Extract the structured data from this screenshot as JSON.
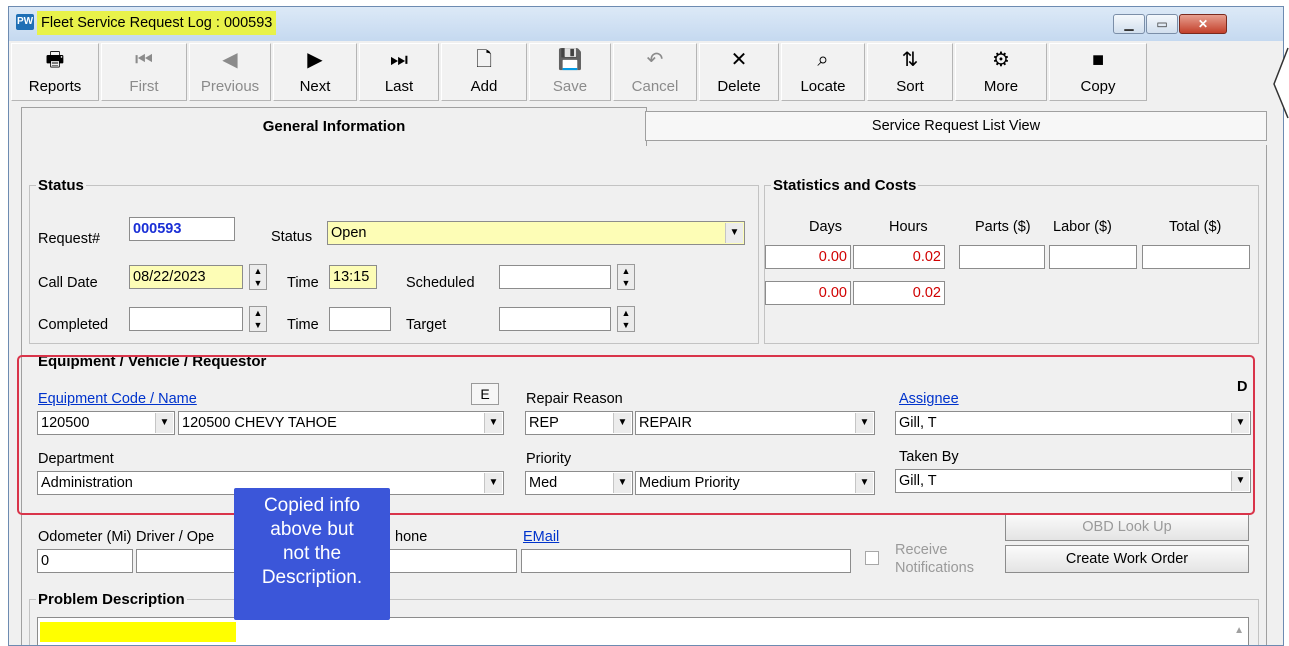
{
  "window": {
    "title": "Fleet Service Request Log : 000593",
    "icon": "PW"
  },
  "toolbar": [
    {
      "label": "Reports",
      "icon": "printer-icon",
      "glyph": "🖶",
      "disabled": false
    },
    {
      "label": "First",
      "icon": "first-icon",
      "glyph": "⏮",
      "disabled": true
    },
    {
      "label": "Previous",
      "icon": "previous-icon",
      "glyph": "◀",
      "disabled": true
    },
    {
      "label": "Next",
      "icon": "next-icon",
      "glyph": "▶",
      "disabled": false
    },
    {
      "label": "Last",
      "icon": "last-icon",
      "glyph": "⏭",
      "disabled": false
    },
    {
      "label": "Add",
      "icon": "add-page-icon",
      "glyph": "🗋",
      "disabled": false
    },
    {
      "label": "Save",
      "icon": "save-icon",
      "glyph": "💾",
      "disabled": true
    },
    {
      "label": "Cancel",
      "icon": "undo-icon",
      "glyph": "↶",
      "disabled": true
    },
    {
      "label": "Delete",
      "icon": "delete-x-icon",
      "glyph": "✕",
      "disabled": false
    },
    {
      "label": "Locate",
      "icon": "binoculars-icon",
      "glyph": "⌕",
      "disabled": false
    },
    {
      "label": "Sort",
      "icon": "sort-az-icon",
      "glyph": "⇅",
      "disabled": false
    },
    {
      "label": "More",
      "icon": "more-icon",
      "glyph": "⚙",
      "disabled": false
    },
    {
      "label": "Copy",
      "icon": "copy-square-icon",
      "glyph": "■",
      "disabled": false
    }
  ],
  "tabs": {
    "active": "General Information",
    "inactive": "Service Request List View"
  },
  "status": {
    "legend": "Status",
    "request_label": "Request#",
    "request_value": "000593",
    "status_label": "Status",
    "status_value": "Open",
    "call_date_label": "Call Date",
    "call_date_value": "08/22/2023",
    "time_label": "Time",
    "time_value": "13:15",
    "scheduled_label": "Scheduled",
    "scheduled_value": "",
    "completed_label": "Completed",
    "completed_value": "",
    "time2_label": "Time",
    "time2_value": "",
    "target_label": "Target",
    "target_value": ""
  },
  "stats": {
    "legend": "Statistics and Costs",
    "headers": {
      "days": "Days",
      "hours": "Hours",
      "parts": "Parts ($)",
      "labor": "Labor ($)",
      "total": "Total ($)"
    },
    "row1": {
      "days": "0.00",
      "hours": "0.02",
      "parts": "",
      "labor": "",
      "total": ""
    },
    "row2": {
      "days": "0.00",
      "hours": "0.02"
    }
  },
  "equipment": {
    "legend": "Equipment / Vehicle / Requestor",
    "code_label": "Equipment Code / Name",
    "e_button": "E",
    "d_label": "D",
    "code_value": "120500",
    "name_value": "120500 CHEVY TAHOE",
    "repair_reason_label": "Repair Reason",
    "repair_code": "REP",
    "repair_desc": "REPAIR",
    "assignee_label": "Assignee",
    "assignee_value": "Gill, T",
    "department_label": "Department",
    "department_value": "Administration",
    "priority_label": "Priority",
    "priority_code": "Med",
    "priority_desc": "Medium Priority",
    "taken_by_label": "Taken By",
    "taken_by_value": "Gill, T"
  },
  "contact": {
    "odometer_label": "Odometer (Mi)",
    "odometer_value": "0",
    "driver_label": "Driver / Ope",
    "driver_value": "",
    "phone_label": "hone",
    "phone_value": "",
    "email_label": "EMail",
    "email_value": "",
    "receive_label_1": "Receive",
    "receive_label_2": "Notifications",
    "obd_button": "OBD Look Up",
    "create_wo_button": "Create Work Order"
  },
  "problem": {
    "legend": "Problem Description",
    "value": ""
  },
  "callout": {
    "lines": [
      "Copied info",
      "above but",
      "not the",
      "Description."
    ]
  },
  "colors": {
    "highlight": "#e8f24a",
    "callout_bg": "#3b56d9",
    "red_box": "#d9344a",
    "link": "#0033cc",
    "stat_red": "#d00000"
  }
}
